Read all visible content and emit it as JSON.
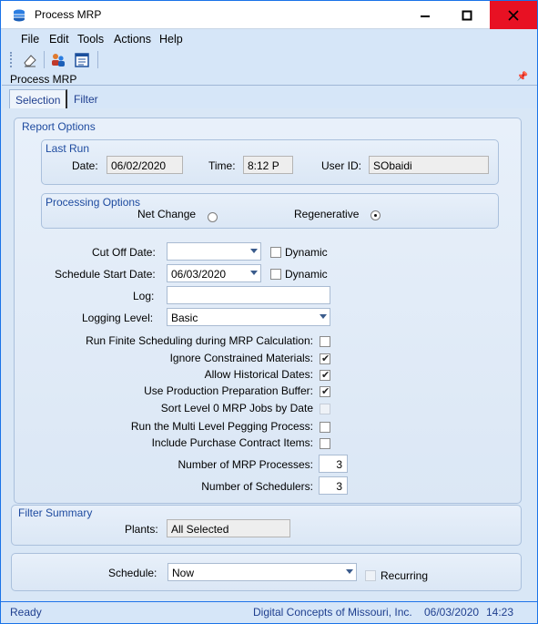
{
  "window": {
    "title": "Process MRP"
  },
  "menu": [
    "File",
    "Edit",
    "Tools",
    "Actions",
    "Help"
  ],
  "panel_title": "Process MRP",
  "tabs": [
    "Selection",
    "Filter"
  ],
  "report_options": {
    "title": "Report Options",
    "last_run": {
      "title": "Last Run",
      "date_label": "Date:",
      "date_value": "06/02/2020",
      "time_label": "Time:",
      "time_value": "8:12 P",
      "user_label": "User ID:",
      "user_value": "SObaidi"
    },
    "processing": {
      "title": "Processing Options",
      "net_change_label": "Net Change",
      "regenerative_label": "Regenerative",
      "selected": "Regenerative"
    },
    "cutoff_label": "Cut Off Date:",
    "cutoff_value": "",
    "dynamic_label": "Dynamic",
    "schedule_start_label": "Schedule Start Date:",
    "schedule_start_value": "06/03/2020",
    "log_label": "Log:",
    "log_value": "",
    "logging_level_label": "Logging Level:",
    "logging_level_value": "Basic",
    "checks": [
      {
        "label": "Run Finite Scheduling during MRP Calculation:",
        "checked": false,
        "disabled": false
      },
      {
        "label": "Ignore Constrained Materials:",
        "checked": true,
        "disabled": false
      },
      {
        "label": "Allow Historical Dates:",
        "checked": true,
        "disabled": false
      },
      {
        "label": "Use Production Preparation Buffer:",
        "checked": true,
        "disabled": false
      },
      {
        "label": "Sort Level 0 MRP Jobs by Date",
        "checked": false,
        "disabled": true
      },
      {
        "label": "Run the Multi Level Pegging Process:",
        "checked": false,
        "disabled": false
      },
      {
        "label": "Include Purchase Contract Items:",
        "checked": false,
        "disabled": false
      }
    ],
    "num_mrp_label": "Number of MRP Processes:",
    "num_mrp_value": "3",
    "num_sched_label": "Number of Schedulers:",
    "num_sched_value": "3"
  },
  "filter_summary": {
    "title": "Filter Summary",
    "plants_label": "Plants:",
    "plants_value": "All Selected"
  },
  "schedule": {
    "label": "Schedule:",
    "value": "Now",
    "recurring_label": "Recurring"
  },
  "status": {
    "left": "Ready",
    "company": "Digital Concepts of Missouri, Inc.",
    "date": "06/03/2020",
    "time": "14:23"
  },
  "colors": {
    "accent": "#1f73e8",
    "close": "#e81123",
    "group_title": "#1d4a9f"
  },
  "icons": [
    "app-icon",
    "minimize-icon",
    "maximize-icon",
    "close-icon",
    "eraser-icon",
    "people-icon",
    "report-icon",
    "pin-icon"
  ]
}
